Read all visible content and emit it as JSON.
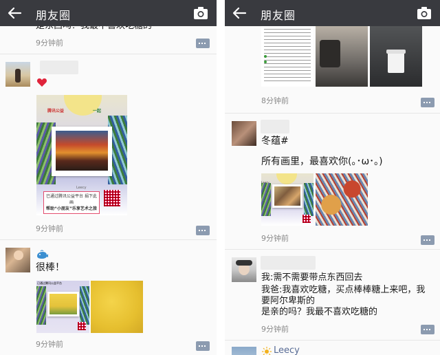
{
  "left": {
    "topbar": {
      "title": "朋友圈"
    },
    "post0": {
      "text_cut": "是东西吗？我最不喜欢吃糖的",
      "time": "9分钟前"
    },
    "post1": {
      "time": "9分钟前",
      "poster": {
        "brand_a": "腾讯公益",
        "brand_b": "一起",
        "name": "Leecy",
        "caption_1": "已通过腾讯公益平台  捐下此画",
        "caption_2": "帮助“小朋友”乐享艺术之旅"
      }
    },
    "post2": {
      "text": "很棒！",
      "time": "9分钟前",
      "poster_caption": "已通过腾讯公益平台"
    }
  },
  "right": {
    "topbar": {
      "title": "朋友圈"
    },
    "post0": {
      "time": "8分钟前"
    },
    "post1": {
      "line1": "冬蕴#",
      "line2": "所有画里，最喜欢你(｡･ω･｡)",
      "time": "9分钟前",
      "poster_name": "Leecy"
    },
    "post2": {
      "line1": "我:需不需要带点东西回去",
      "line2": "我爸:我喜欢吃糖，买点棒棒糖上来吧，我",
      "line3": "要阿尔卑斯的",
      "line4": "是亲的吗？我最不喜欢吃糖的",
      "time": "9分钟前"
    },
    "post3": {
      "name": "Leecy"
    }
  },
  "icons": {
    "back": "back-arrow-icon",
    "camera": "camera-icon",
    "comment": "comment-icon",
    "heart": "heart-icon",
    "whale": "whale-icon",
    "sun": "sun-icon"
  },
  "colors": {
    "topbar": "#393a3f",
    "link_blue": "#576b95",
    "comment_btn": "#8c9bb0",
    "heart": "#e0243b"
  }
}
